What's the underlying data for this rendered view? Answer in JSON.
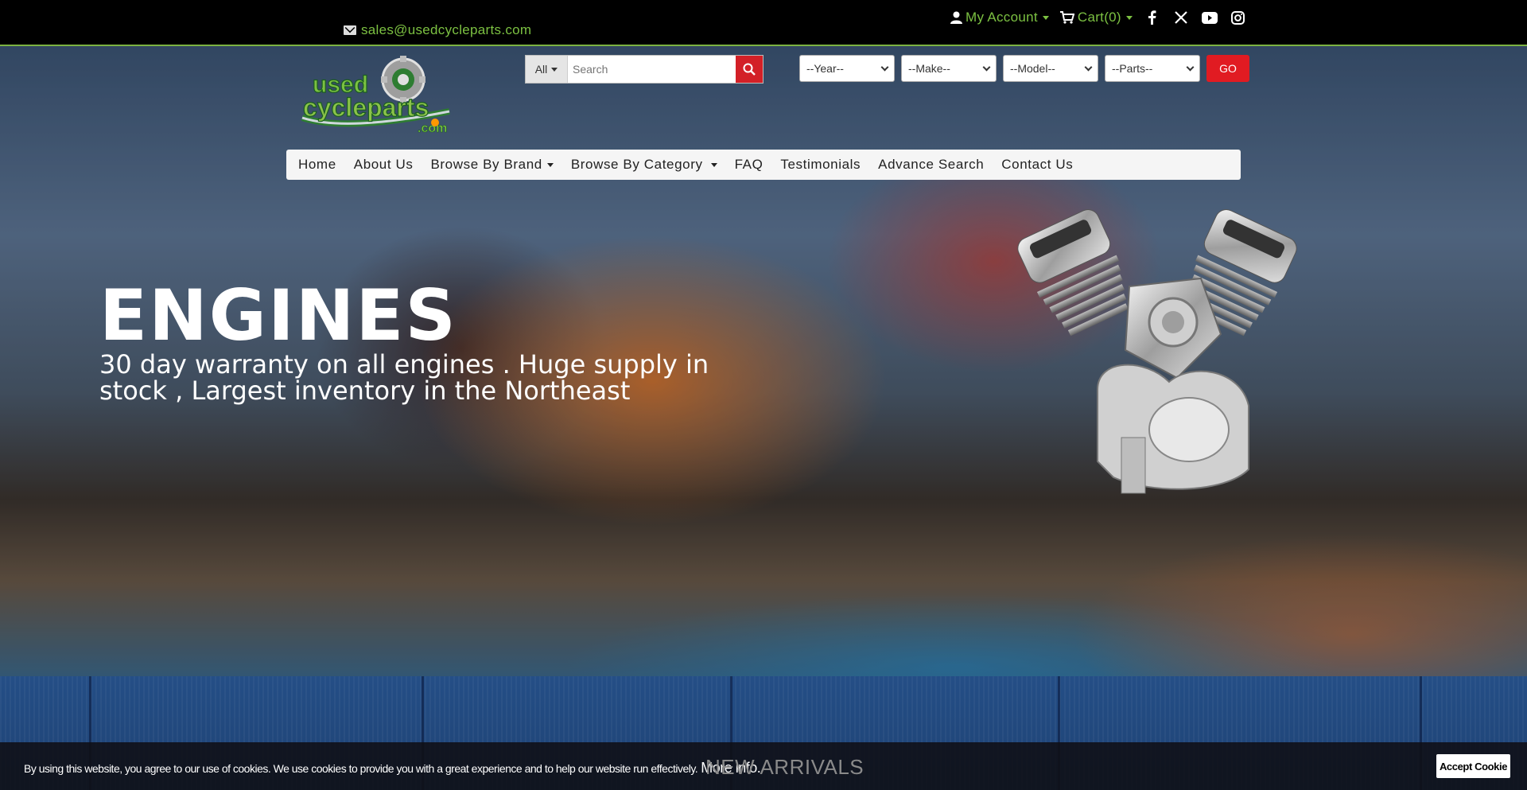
{
  "topbar": {
    "email": "sales@usedcycleparts.com",
    "my_account": "My Account",
    "cart": "Cart(0)"
  },
  "social": [
    "facebook-icon",
    "x-icon",
    "youtube-icon",
    "instagram-icon"
  ],
  "logo": {
    "line1": "used",
    "line2": "cycleparts",
    "line3": ".com"
  },
  "search": {
    "scope": "All",
    "placeholder": "Search"
  },
  "filters": {
    "year": "--Year--",
    "make": "--Make--",
    "model": "--Model--",
    "parts": "--Parts--",
    "go": "GO"
  },
  "nav": {
    "home": "Home",
    "about": "About Us",
    "brand": "Browse By Brand",
    "category": "Browse By Category",
    "faq": "FAQ",
    "testimonials": "Testimonials",
    "advance": "Advance Search",
    "contact": "Contact Us"
  },
  "hero": {
    "title": "ENGINES",
    "subtitle": "30 day warranty on all engines . Huge supply in stock , Largest inventory in the Northeast"
  },
  "section": {
    "heading": "NEW ARRIVALS"
  },
  "cookie": {
    "text": "By using this website, you agree to our use of cookies. We use cookies to provide you with a great experience and to help our website run effectively.",
    "more": "More info.",
    "accept": "Accept Cookie"
  },
  "colors": {
    "accent_green": "#7cc142",
    "brand_red": "#e11b22"
  }
}
